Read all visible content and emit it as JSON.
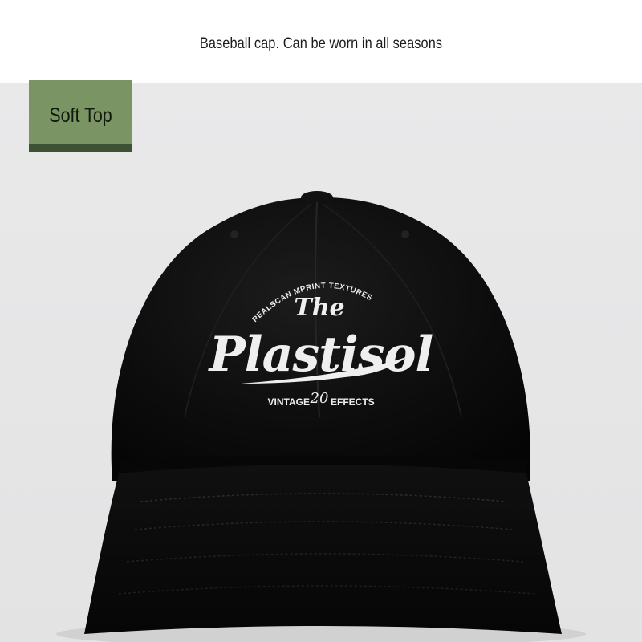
{
  "header": {
    "caption": "Baseball cap. Can be worn in all seasons"
  },
  "badge": {
    "label": "Soft Top",
    "color": "#7a9463",
    "stripe_color": "#3d5135"
  },
  "product": {
    "cap_color": "#0b0b0b",
    "print_color": "#f0f0f0",
    "print": {
      "arc_text": "REALSCAN MPRINT TEXTURES",
      "the": "The",
      "word": "Plastisol",
      "bottom_left": "VINTAGE",
      "number": "20",
      "bottom_right": "EFFECTS"
    }
  }
}
